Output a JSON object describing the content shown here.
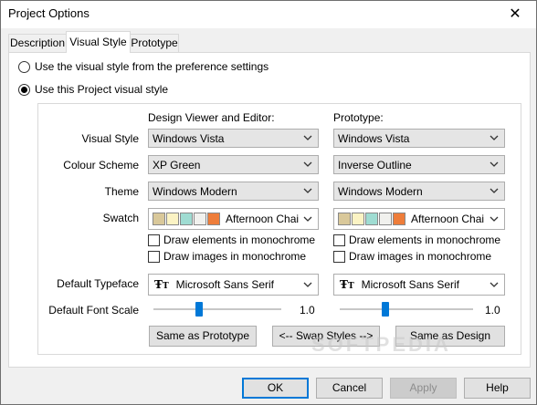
{
  "window": {
    "title": "Project Options",
    "close_glyph": "✕"
  },
  "tabs": [
    {
      "label": "Description"
    },
    {
      "label": "Visual Style"
    },
    {
      "label": "Prototype"
    }
  ],
  "options": {
    "use_preference": "Use the visual style from the preference settings",
    "use_project": "Use this Project visual style"
  },
  "columns": {
    "design": "Design Viewer and Editor:",
    "prototype": "Prototype:"
  },
  "labels": {
    "visual_style": "Visual Style",
    "colour_scheme": "Colour Scheme",
    "theme": "Theme",
    "swatch": "Swatch",
    "default_typeface": "Default Typeface",
    "default_font_scale": "Default Font Scale"
  },
  "design": {
    "visual_style": "Windows Vista",
    "colour_scheme": "XP Green",
    "theme": "Windows Modern",
    "swatch_name": "Afternoon Chai",
    "swatch_colors": [
      "#d9c89a",
      "#fbf3c4",
      "#9fdcd2",
      "#f1f1ee",
      "#ee7d3a"
    ],
    "mono_elements": "Draw elements in monochrome",
    "mono_images": "Draw images in monochrome",
    "typeface": "Microsoft Sans Serif",
    "font_scale_text": "1.0",
    "font_scale": 1.0
  },
  "prototype": {
    "visual_style": "Windows Vista",
    "colour_scheme": "Inverse Outline",
    "theme": "Windows Modern",
    "swatch_name": "Afternoon Chai",
    "swatch_colors": [
      "#d9c89a",
      "#fbf3c4",
      "#9fdcd2",
      "#f1f1ee",
      "#ee7d3a"
    ],
    "mono_elements": "Draw elements in monochrome",
    "mono_images": "Draw images in monochrome",
    "typeface": "Microsoft Sans Serif",
    "font_scale_text": "1.0",
    "font_scale": 1.0
  },
  "buttons": {
    "same_as_prototype": "Same as Prototype",
    "swap_styles": "<-- Swap  Styles -->",
    "same_as_design": "Same as Design",
    "ok": "OK",
    "cancel": "Cancel",
    "apply": "Apply",
    "help": "Help"
  },
  "watermark": "SOFTPEDIA"
}
